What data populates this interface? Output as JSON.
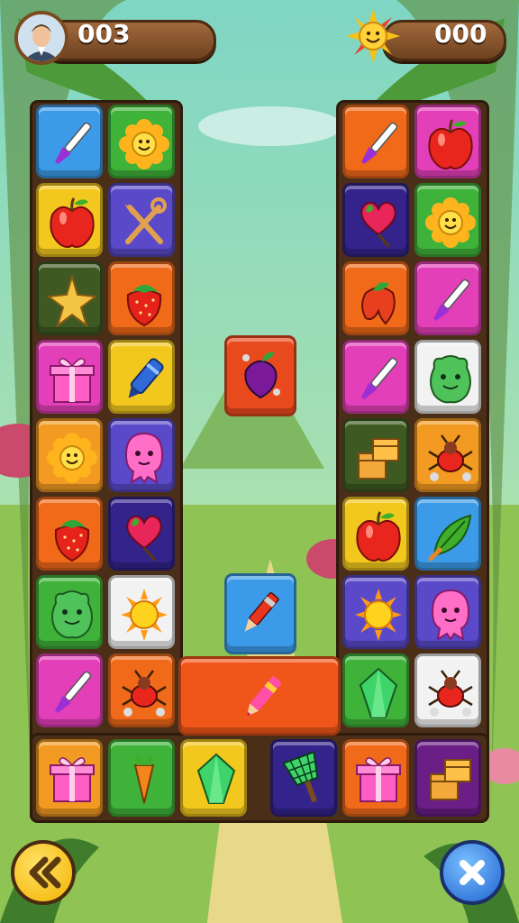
{
  "hud": {
    "left_score": "003",
    "right_score": "000",
    "left_icon": "player-portrait-icon",
    "right_icon": "smiling-sun-icon"
  },
  "colors": {
    "blue": "#3c9be8",
    "green": "#3fb23a",
    "yellow": "#f2c81e",
    "purple": "#5a49c8",
    "darkgreen": "#3e5a22",
    "orange": "#f06a1a",
    "pink": "#e33fb8",
    "amber": "#f29a22",
    "navy": "#33238a",
    "white": "#f2f2f2",
    "violet": "#6a1e86",
    "red": "#e84a1e"
  },
  "left_grid": [
    {
      "color": "blue",
      "icon": "paintbrush-icon"
    },
    {
      "color": "green",
      "icon": "sunflower-icon"
    },
    {
      "color": "yellow",
      "icon": "apple-icon"
    },
    {
      "color": "purple",
      "icon": "crossed-tools-icon"
    },
    {
      "color": "darkgreen",
      "icon": "star-icon"
    },
    {
      "color": "orange",
      "icon": "strawberry-icon"
    },
    {
      "color": "pink",
      "icon": "gift-box-icon"
    },
    {
      "color": "yellow",
      "icon": "marker-icon"
    },
    {
      "color": "amber",
      "icon": "sunflower-icon"
    },
    {
      "color": "purple",
      "icon": "pink-blob-creature-icon"
    },
    {
      "color": "orange",
      "icon": "strawberry-icon"
    },
    {
      "color": "navy",
      "icon": "heart-balloon-icon"
    },
    {
      "color": "green",
      "icon": "green-blob-creature-icon"
    },
    {
      "color": "white",
      "icon": "sun-icon"
    },
    {
      "color": "pink",
      "icon": "paintbrush-icon"
    },
    {
      "color": "orange",
      "icon": "bug-icon"
    }
  ],
  "right_grid": [
    {
      "color": "orange",
      "icon": "paintbrush-icon"
    },
    {
      "color": "pink",
      "icon": "apple-icon"
    },
    {
      "color": "navy",
      "icon": "heart-balloon-icon"
    },
    {
      "color": "green",
      "icon": "sunflower-icon"
    },
    {
      "color": "orange",
      "icon": "pepper-icon"
    },
    {
      "color": "pink",
      "icon": "paintbrush-icon"
    },
    {
      "color": "pink",
      "icon": "paintbrush-icon"
    },
    {
      "color": "white",
      "icon": "green-blob-creature-icon"
    },
    {
      "color": "darkgreen",
      "icon": "boxes-icon"
    },
    {
      "color": "amber",
      "icon": "bug-icon"
    },
    {
      "color": "yellow",
      "icon": "apple-icon"
    },
    {
      "color": "blue",
      "icon": "leaf-icon"
    },
    {
      "color": "purple",
      "icon": "sun-icon"
    },
    {
      "color": "purple",
      "icon": "pink-blob-creature-icon"
    },
    {
      "color": "green",
      "icon": "crystal-icon"
    },
    {
      "color": "white",
      "icon": "bug-icon"
    }
  ],
  "bottom_row": [
    {
      "color": "amber",
      "icon": "gift-box-icon"
    },
    {
      "color": "green",
      "icon": "carrot-icon"
    },
    {
      "color": "yellow",
      "icon": "crystal-icon"
    },
    {
      "color": "navy",
      "icon": "net-icon"
    },
    {
      "color": "orange",
      "icon": "gift-box-icon"
    },
    {
      "color": "violet",
      "icon": "boxes-icon"
    }
  ],
  "floating_tiles": [
    {
      "color": "red",
      "icon": "beet-icon"
    },
    {
      "color": "blue",
      "icon": "crayon-icon"
    },
    {
      "color": "orange",
      "icon": "crayon-icon"
    }
  ],
  "buttons": {
    "back_icon": "double-chevron-left-icon",
    "close_icon": "close-icon"
  }
}
